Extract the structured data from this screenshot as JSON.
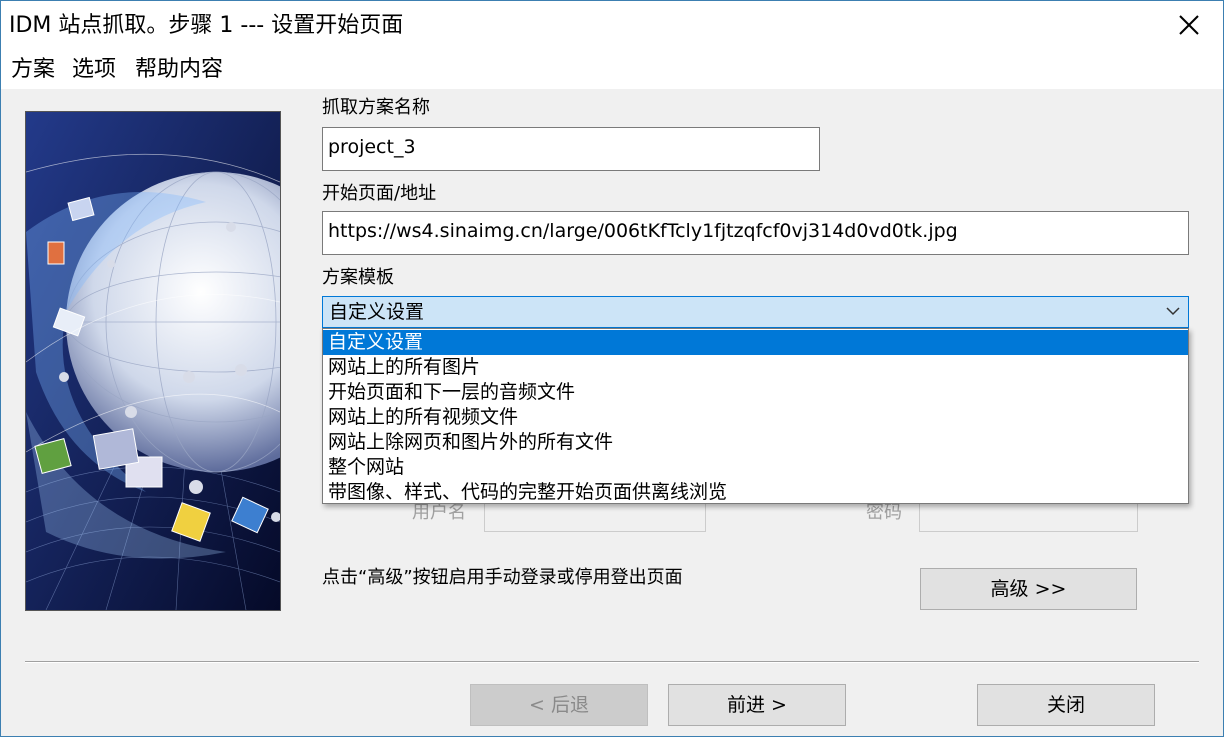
{
  "window": {
    "title": "IDM 站点抓取。步骤 1 --- 设置开始页面"
  },
  "menu": [
    "方案",
    "选项",
    "帮助内容"
  ],
  "form": {
    "project_name_label": "抓取方案名称",
    "project_name_value": "project_3",
    "start_page_label": "开始页面/地址",
    "start_page_value": "https://ws4.sinaimg.cn/large/006tKfTcly1fjtzqfcf0vj314d0vd0tk.jpg",
    "template_label": "方案模板",
    "template_selected": "自定义设置",
    "template_options": [
      "自定义设置",
      "网站上的所有图片",
      "开始页面和下一层的音频文件",
      "网站上的所有视频文件",
      "网站上除网页和图片外的所有文件",
      "整个网站",
      "带图像、样式、代码的完整开始页面供离线浏览"
    ],
    "username_label": "用户名",
    "password_label": "密码",
    "advanced_hint": "点击“高级”按钮启用手动登录或停用登出页面",
    "advanced_button": "高级 >>"
  },
  "buttons": {
    "back": "< 后退",
    "next": "前进 >",
    "close": "关闭"
  },
  "colors": {
    "accent": "#0078d7",
    "combo_bg": "#cce4f7",
    "window_bg": "#f0f0f0"
  }
}
